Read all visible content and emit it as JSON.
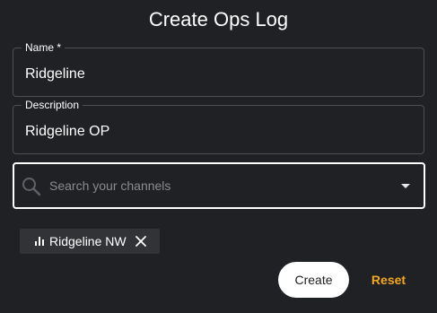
{
  "dialog": {
    "title": "Create Ops Log"
  },
  "fields": {
    "name": {
      "label": "Name *",
      "value": "Ridgeline"
    },
    "description": {
      "label": "Description",
      "value": "Ridgeline OP"
    },
    "search": {
      "placeholder": "Search your channels",
      "value": ""
    }
  },
  "selected_channels": [
    {
      "label": "Ridgeline NW",
      "icon": "bar-chart-icon"
    }
  ],
  "actions": {
    "create_label": "Create",
    "reset_label": "Reset"
  },
  "colors": {
    "background": "#202124",
    "accent": "#f5a623",
    "chip_background": "#323336",
    "field_border": "#4d4f53",
    "focused_border": "#ffffff"
  },
  "icons": {
    "search": "search-icon",
    "dropdown": "chevron-down-icon",
    "chip": "bar-chart-icon",
    "remove": "close-icon"
  }
}
